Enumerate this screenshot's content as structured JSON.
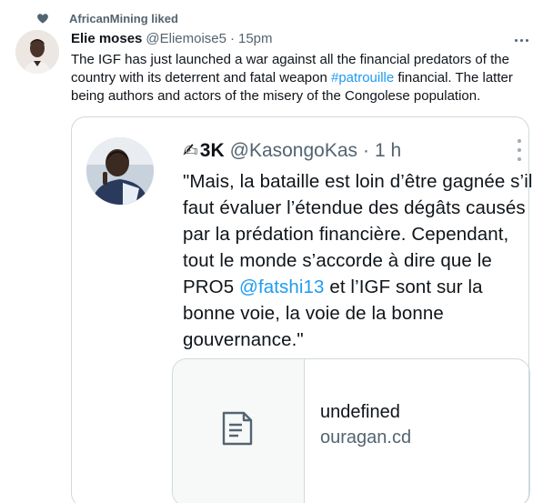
{
  "social_context": {
    "text": "AfricanMining liked",
    "icon": "heart-icon"
  },
  "tweet": {
    "author_name": "Elie moses",
    "author_handle": "@Eliemoise5",
    "separator": "·",
    "timestamp": "15pm",
    "text_before": "The IGF has just launched a war against all the financial predators of the country with its deterrent and fatal weapon ",
    "hashtag": "#patrouille",
    "text_after": " financial. The latter being authors and actors of the misery of the Congolese population."
  },
  "quote": {
    "emoji": "✍",
    "author_name": "3K",
    "author_handle": "@KasongoKas",
    "separator": "·",
    "timestamp": "1 h",
    "text_before": "\"Mais, la bataille est loin d’être gagnée s’il faut évaluer l’étendue des dégâts causés par la prédation financière. Cependant, tout le monde s’accorde à dire que le PRO5 ",
    "mention": "@fatshi13",
    "text_after": " et l’IGF sont sur la bonne voie, la voie de la bonne gouvernance.\""
  },
  "link_card": {
    "title": "undefined",
    "domain": "ouragan.cd",
    "icon": "document-icon"
  },
  "colors": {
    "accent": "#1d9bf0",
    "muted": "#536471",
    "border": "#cfd9de"
  }
}
